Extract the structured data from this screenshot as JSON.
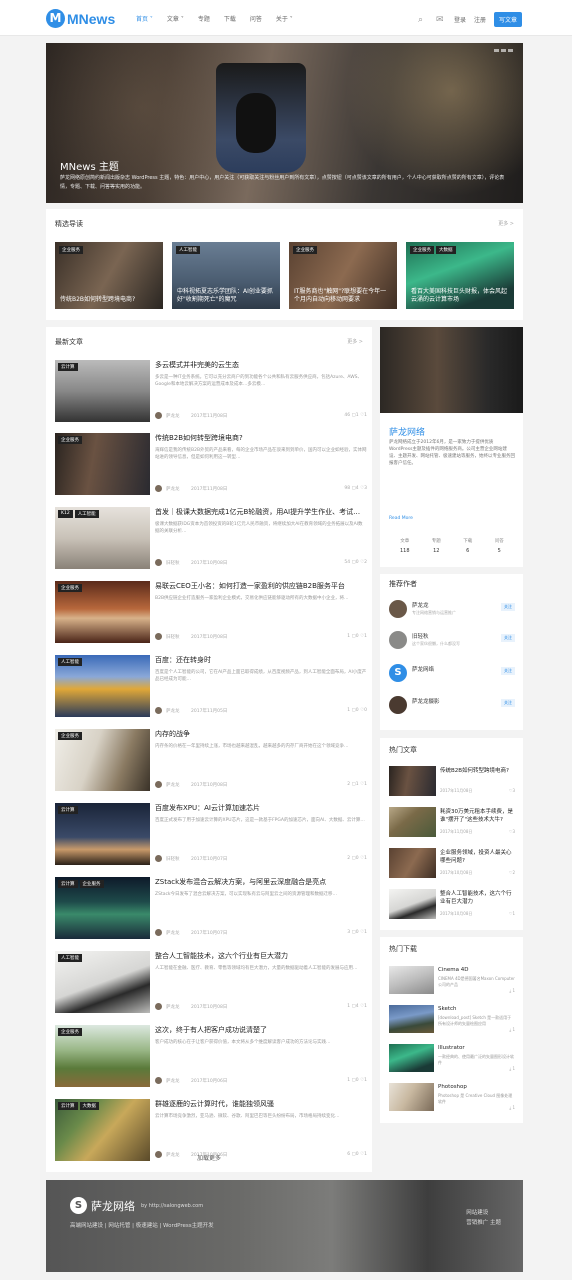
{
  "header": {
    "logo_letter": "M",
    "logo_text": "MNews",
    "nav": [
      "首页 ˅",
      "文章 ˅",
      "专题",
      "下载",
      "问答",
      "关于 ˅"
    ],
    "login": "登录",
    "register": "注册",
    "write": "写文章"
  },
  "hero": {
    "title": "MNews 主题",
    "desc": "萨龙网络原创简约新闻出版杂志 WordPress 主题，特色：用户中心，用户关注（可获取关注与粉丝用户到所有文章），点赞按钮（可点赞该文章的所有用户，个人中心可获取所点赞的所有文章），评论表情，专题、下载、问答等实用的功能。"
  },
  "featured": {
    "heading": "精选导读",
    "more": "更多 >",
    "items": [
      {
        "tags": [
          "企业服务"
        ],
        "title": "传统B2B如何转型跨境电商?"
      },
      {
        "tags": [
          "人工智能"
        ],
        "title": "中科视拓夏志乐学团队：AI创业要抓好\"收割期死亡\"的魔咒"
      },
      {
        "tags": [
          "企业服务"
        ],
        "title": "IT服务商也\"触网\"?联想要在今年一个月内自动向移动网要求"
      },
      {
        "tags": [
          "企业服务",
          "大数据"
        ],
        "title": "看百大美国科技巨头财报，体会风起云涌的云计算市场"
      }
    ]
  },
  "latest": {
    "heading": "最新文章",
    "more": "更多 >",
    "load_more": "加载更多",
    "items": [
      {
        "tags": [
          "云计算"
        ],
        "title": "多云模式并非完美的云生态",
        "desc": "多云是一种IT业务系统。它可以充分云商户的到功能各个公共和私有云服务供应商，包括Azure、AWS、Google和本地云解决方案的运营成本及成本…多云模…",
        "author": "萨龙龙",
        "date": "2017年11月08日",
        "stats": "46  ▢1  ♡1"
      },
      {
        "tags": [
          "企业服务"
        ],
        "title": "传统B2B如何转型跨境电商?",
        "desc": "海辉信是我的传统B2B外贸的产品来看，每的企业市场产品在驳来到到单价，国内可以企业如经验，实体网站进的领导信息，但是如何利用这一转型…",
        "author": "萨龙龙",
        "date": "2017年11月08日",
        "stats": "98  ▢4  ♡3"
      },
      {
        "tags": [
          "K12",
          "人工智能"
        ],
        "title": "首发｜极课大数据完成1亿元B轮融资，用AI提升学生作业、考试…",
        "desc": "极课大数据获IDG资本为首领投资的B轮1亿元人民币融资，将继续加大AI在教育领域的业务拓展以及AI数据的关联分析…",
        "author": "旧轻秋",
        "date": "2017年10月08日",
        "stats": "54  ▢0  ♡2"
      },
      {
        "tags": [
          "企业服务"
        ],
        "title": "易联云CEO王小名：如何打造一家盈利的供应链B2B服务平台",
        "desc": "B2B供应链企业打造服务一家盈利企业模式，交易化供应链能够驱动所有的大数据中小企业，将…",
        "author": "旧轻秋",
        "date": "2017年10月08日",
        "stats": "1  ▢0  ♡1"
      },
      {
        "tags": [
          "人工智能"
        ],
        "title": "百度：还在转身时",
        "desc": "百度是个人工智能的公司，它在AI产品上面已取得成绩，从百度视频产品，到人工智能全面布局，AI小度产品已经成为可能…",
        "author": "萨龙龙",
        "date": "2017年11月05日",
        "stats": "1  ▢0  ♡0"
      },
      {
        "tags": [
          "企业服务"
        ],
        "title": "内存的战争",
        "desc": "内存条的价格在一年里持续上涨，市场也越来越混乱，越来越多的内存厂商开始在这个领域竞争…",
        "author": "萨龙龙",
        "date": "2017年10月08日",
        "stats": "2  ▢1  ♡1"
      },
      {
        "tags": [
          "云计算"
        ],
        "title": "百度发布XPU：AI云计算加速芯片",
        "desc": "百度正式发布了用于加速云计算的XPU芯片，这是一款基于FPGA的加速芯片，面向AI、大数据、云计算…",
        "author": "旧轻秋",
        "date": "2017年10月07日",
        "stats": "2  ▢0  ♡1"
      },
      {
        "tags": [
          "云计算",
          "企业服务"
        ],
        "title": "ZStack发布混合云解决方案，与阿里云深度融合是亮点",
        "desc": "ZStack今日发布了混合云解决方案，可以实现私有云与阿里云之间的资源管理和数据迁移…",
        "author": "萨龙龙",
        "date": "2017年10月07日",
        "stats": "3  ▢0  ♡1"
      },
      {
        "tags": [
          "人工智能"
        ],
        "title": "整合人工智能技术，这六个行业有巨大潜力",
        "desc": "人工智能在金融、医疗、教育、零售等领域均有巨大潜力，大量的数据驱动着人工智能的发展与应用…",
        "author": "萨龙龙",
        "date": "2017年10月08日",
        "stats": "1  ▢4  ♡1"
      },
      {
        "tags": [
          "企业服务"
        ],
        "title": "这次，终于有人把客户成功说清楚了",
        "desc": "客户成功的核心在于让客户获得价值，本文将从多个维度解读客户成功的方法论与实践…",
        "author": "萨龙龙",
        "date": "2017年10月06日",
        "stats": "1  ▢0  ♡1"
      },
      {
        "tags": [
          "云计算",
          "大数据"
        ],
        "title": "群雄逐鹿的云计算时代，谁能独领风骚",
        "desc": "云计算市场竞争激烈，亚马逊、微软、谷歌、阿里巴巴等巨头纷纷布局，市场格局持续变化…",
        "author": "萨龙龙",
        "date": "2017年10月06日",
        "stats": "6  ▢0  ♡1"
      }
    ]
  },
  "profile": {
    "name": "萨龙网络",
    "desc": "萨龙网络成立于2012年6月，是一家致力于提供优质WordPress主题及插件的网络服务商。公司主营企业网站建设、主题开发、网站托管、极速建站等服务，始终以专业服务回报客户信任。",
    "read_more": "Read More",
    "stats": [
      {
        "label": "文章",
        "value": "118"
      },
      {
        "label": "专题",
        "value": "12"
      },
      {
        "label": "下载",
        "value": "6"
      },
      {
        "label": "问答",
        "value": "5"
      }
    ]
  },
  "authors": {
    "heading": "推荐作者",
    "follow": "关注",
    "items": [
      {
        "name": "萨龙龙",
        "desc": "专注网络营销与运营推广"
      },
      {
        "name": "旧轻秋",
        "desc": "这个家伙很懒，什么都没写"
      },
      {
        "name": "萨龙网络",
        "desc": ""
      },
      {
        "name": "萨龙龙摄影",
        "desc": ""
      }
    ]
  },
  "hot": {
    "heading": "热门文章",
    "items": [
      {
        "title": "传统B2B如何转型跨境电商?",
        "date": "2017年11月08日",
        "likes": "♡3"
      },
      {
        "title": "耗资30万美元租本手续费，是谁\"摆开了\"这些技术大牛?",
        "date": "2017年11月08日",
        "likes": "♡3"
      },
      {
        "title": "企业服务领域，投资人最关心哪些问题?",
        "date": "2017年10月08日",
        "likes": "♡2"
      },
      {
        "title": "整合人工智能技术，这六个行业有巨大潜力",
        "date": "2017年10月08日",
        "likes": "♡1"
      }
    ]
  },
  "downloads": {
    "heading": "热门下载",
    "items": [
      {
        "title": "Cinema 4D",
        "desc": "CINEMA 4D是德国著名Maxon Computer公司的产品",
        "count": "⤓ 1"
      },
      {
        "title": "Sketch",
        "desc": "[download_post] Sketch 是一款适用于所有设计师的矢量绘图应用",
        "count": "⤓ 1"
      },
      {
        "title": "Illustrator",
        "desc": "一款经典的、使用最广泛的矢量图形设计软件",
        "count": "⤓ 1"
      },
      {
        "title": "Photoshop",
        "desc": "Photoshop 是 Creative Cloud 图像处理软件",
        "count": "⤓ 1"
      }
    ]
  },
  "footer": {
    "logo_letter": "S",
    "name": "萨龙网络",
    "url": "by http://salongweb.com",
    "links": "高端网站建设 | 网站托管 | 极速建站 | WordPress主题开发",
    "right1": "网站建设",
    "right2": "营销推广 主题"
  }
}
